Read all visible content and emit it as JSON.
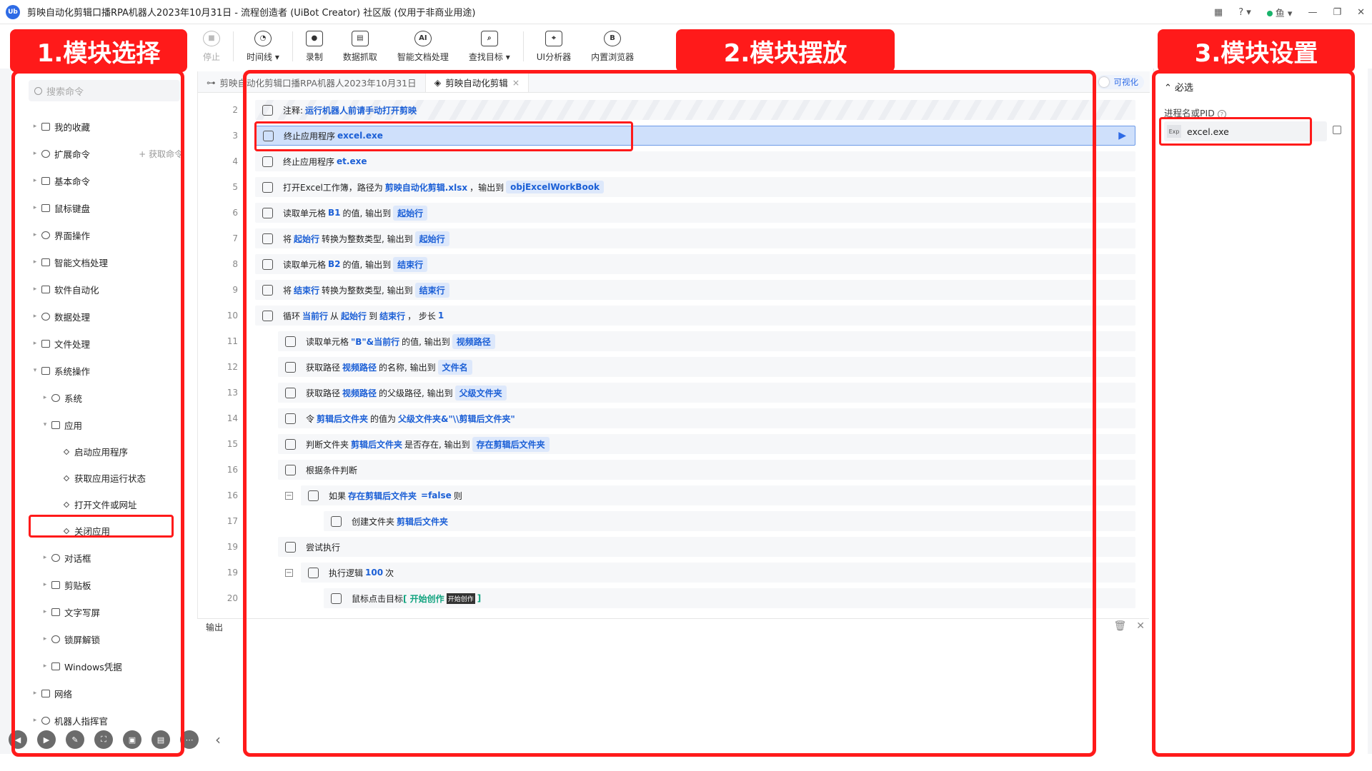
{
  "window": {
    "logo": "Ub",
    "title": "剪映自动化剪辑口播RPA机器人2023年10月31日 - 流程创造者 (UiBot Creator) 社区版 (仅用于非商业用途)",
    "user": "鱼"
  },
  "toolbar": {
    "items": [
      {
        "label": "停止",
        "icon": "stop-icon",
        "disabled": true
      },
      {
        "label": "时间线 ▾",
        "icon": "clock-icon"
      },
      {
        "label": "录制",
        "icon": "record-icon"
      },
      {
        "label": "数据抓取",
        "icon": "data-grab-icon"
      },
      {
        "label": "智能文档处理",
        "icon": "ai-doc-icon"
      },
      {
        "label": "查找目标 ▾",
        "icon": "find-target-icon"
      },
      {
        "label": "UI分析器",
        "icon": "ui-analyzer-icon"
      },
      {
        "label": "内置浏览器",
        "icon": "browser-icon"
      }
    ]
  },
  "annotations": {
    "left": "1.模块选择",
    "center": "2.模块摆放",
    "right": "3.模块设置"
  },
  "left_panel": {
    "search_placeholder": "搜索命令",
    "extend_action": "获取命令",
    "tree": [
      {
        "label": "我的收藏",
        "level": 0,
        "arrow": "▸"
      },
      {
        "label": "扩展命令",
        "level": 0,
        "arrow": "▸"
      },
      {
        "label": "基本命令",
        "level": 0,
        "arrow": "▸"
      },
      {
        "label": "鼠标键盘",
        "level": 0,
        "arrow": "▸"
      },
      {
        "label": "界面操作",
        "level": 0,
        "arrow": "▸"
      },
      {
        "label": "智能文档处理",
        "level": 0,
        "arrow": "▸"
      },
      {
        "label": "软件自动化",
        "level": 0,
        "arrow": "▸"
      },
      {
        "label": "数据处理",
        "level": 0,
        "arrow": "▸"
      },
      {
        "label": "文件处理",
        "level": 0,
        "arrow": "▸"
      },
      {
        "label": "系统操作",
        "level": 0,
        "arrow": "▾"
      },
      {
        "label": "系统",
        "level": 1,
        "arrow": "▸"
      },
      {
        "label": "应用",
        "level": 1,
        "arrow": "▾"
      },
      {
        "label": "启动应用程序",
        "level": 2,
        "arrow": ""
      },
      {
        "label": "获取应用运行状态",
        "level": 2,
        "arrow": ""
      },
      {
        "label": "打开文件或网址",
        "level": 2,
        "arrow": ""
      },
      {
        "label": "关闭应用",
        "level": 2,
        "arrow": ""
      },
      {
        "label": "对话框",
        "level": 1,
        "arrow": "▸"
      },
      {
        "label": "剪贴板",
        "level": 1,
        "arrow": "▸"
      },
      {
        "label": "文字写屏",
        "level": 1,
        "arrow": "▸"
      },
      {
        "label": "锁屏解锁",
        "level": 1,
        "arrow": "▸"
      },
      {
        "label": "Windows凭据",
        "level": 1,
        "arrow": "▸"
      },
      {
        "label": "网络",
        "level": 0,
        "arrow": "▸"
      },
      {
        "label": "机器人指挥官",
        "level": 0,
        "arrow": "▸"
      }
    ]
  },
  "tabs": [
    {
      "label": "剪映自动化剪辑口播RPA机器人2023年10月31日",
      "active": false
    },
    {
      "label": "剪映自动化剪辑",
      "active": true
    }
  ],
  "visual_toggle": "可视化",
  "code_rows": [
    {
      "ln": "2",
      "indent": 0,
      "type": "comment",
      "parts": [
        [
          "t",
          "注释: "
        ],
        [
          "kw",
          "运行机器人前请手动打开剪映"
        ]
      ]
    },
    {
      "ln": "3",
      "indent": 0,
      "type": "selected",
      "parts": [
        [
          "t",
          "终止应用程序 "
        ],
        [
          "kw",
          "excel.exe"
        ]
      ]
    },
    {
      "ln": "4",
      "indent": 0,
      "parts": [
        [
          "t",
          "终止应用程序 "
        ],
        [
          "kw",
          "et.exe"
        ]
      ]
    },
    {
      "ln": "5",
      "indent": 0,
      "parts": [
        [
          "t",
          "打开Excel工作簿，路径为 "
        ],
        [
          "kw",
          "剪映自动化剪辑.xlsx"
        ],
        [
          "t",
          "，输出到 "
        ],
        [
          "v",
          "objExcelWorkBook"
        ]
      ]
    },
    {
      "ln": "6",
      "indent": 0,
      "parts": [
        [
          "t",
          "读取单元格 "
        ],
        [
          "kw",
          "B1"
        ],
        [
          "t",
          " 的值, 输出到 "
        ],
        [
          "v",
          "起始行"
        ]
      ]
    },
    {
      "ln": "7",
      "indent": 0,
      "parts": [
        [
          "t",
          "将 "
        ],
        [
          "kw",
          "起始行"
        ],
        [
          "t",
          " 转换为整数类型, 输出到 "
        ],
        [
          "v",
          "起始行"
        ]
      ]
    },
    {
      "ln": "8",
      "indent": 0,
      "parts": [
        [
          "t",
          "读取单元格 "
        ],
        [
          "kw",
          "B2"
        ],
        [
          "t",
          " 的值, 输出到 "
        ],
        [
          "v",
          "结束行"
        ]
      ]
    },
    {
      "ln": "9",
      "indent": 0,
      "parts": [
        [
          "t",
          "将 "
        ],
        [
          "kw",
          "结束行"
        ],
        [
          "t",
          " 转换为整数类型, 输出到 "
        ],
        [
          "v",
          "结束行"
        ]
      ]
    },
    {
      "ln": "10",
      "indent": 0,
      "parts": [
        [
          "t",
          "循环 "
        ],
        [
          "kw",
          "当前行"
        ],
        [
          "t",
          " 从 "
        ],
        [
          "kw",
          "起始行"
        ],
        [
          "t",
          " 到 "
        ],
        [
          "kw",
          "结束行"
        ],
        [
          "t",
          " ， 步长 "
        ],
        [
          "kw",
          "1"
        ]
      ]
    },
    {
      "ln": "11",
      "indent": 1,
      "parts": [
        [
          "t",
          "读取单元格 "
        ],
        [
          "kw",
          "\"B\"&当前行"
        ],
        [
          "t",
          " 的值, 输出到 "
        ],
        [
          "v",
          "视频路径"
        ]
      ]
    },
    {
      "ln": "12",
      "indent": 1,
      "parts": [
        [
          "t",
          "获取路径 "
        ],
        [
          "kw",
          "视频路径"
        ],
        [
          "t",
          " 的名称, 输出到 "
        ],
        [
          "v",
          "文件名"
        ]
      ]
    },
    {
      "ln": "13",
      "indent": 1,
      "parts": [
        [
          "t",
          "获取路径 "
        ],
        [
          "kw",
          "视频路径"
        ],
        [
          "t",
          " 的父级路径, 输出到 "
        ],
        [
          "v",
          "父级文件夹"
        ]
      ]
    },
    {
      "ln": "14",
      "indent": 1,
      "parts": [
        [
          "t",
          "令 "
        ],
        [
          "kw",
          "剪辑后文件夹"
        ],
        [
          "t",
          " 的值为 "
        ],
        [
          "kw",
          "父级文件夹&\"\\\\剪辑后文件夹\""
        ]
      ]
    },
    {
      "ln": "15",
      "indent": 1,
      "parts": [
        [
          "t",
          "判断文件夹 "
        ],
        [
          "kw",
          "剪辑后文件夹"
        ],
        [
          "t",
          " 是否存在, 输出到 "
        ],
        [
          "v",
          "存在剪辑后文件夹"
        ]
      ]
    },
    {
      "ln": "16",
      "indent": 1,
      "parts": [
        [
          "t",
          "根据条件判断"
        ]
      ]
    },
    {
      "ln": "16",
      "indent": 2,
      "fold": true,
      "parts": [
        [
          "t",
          "如果 "
        ],
        [
          "kw",
          "存在剪辑后文件夹"
        ],
        [
          "kw",
          "=false"
        ],
        [
          "t",
          " 则"
        ]
      ]
    },
    {
      "ln": "17",
      "indent": 3,
      "parts": [
        [
          "t",
          "创建文件夹 "
        ],
        [
          "kw",
          "剪辑后文件夹"
        ]
      ]
    },
    {
      "ln": "19",
      "indent": 1,
      "parts": [
        [
          "t",
          "尝试执行"
        ]
      ]
    },
    {
      "ln": "19",
      "indent": 2,
      "fold": true,
      "parts": [
        [
          "t",
          "执行逻辑 "
        ],
        [
          "kw",
          "100"
        ],
        [
          "t",
          " 次"
        ]
      ]
    },
    {
      "ln": "20",
      "indent": 3,
      "parts": [
        [
          "t",
          "鼠标点击目标 "
        ],
        [
          "g",
          "[ 开始创作 "
        ],
        [
          "tag",
          "开始创作"
        ],
        [
          "g",
          " ]"
        ]
      ]
    }
  ],
  "output": {
    "label": "输出"
  },
  "right_panel": {
    "section": "必选",
    "field_label": "进程名或PID",
    "field_value": "excel.exe",
    "field_badge": "Exp"
  },
  "dock": [
    "◀",
    "▶",
    "✎",
    "⛶",
    "▣",
    "▤",
    "⋯",
    "‹"
  ]
}
